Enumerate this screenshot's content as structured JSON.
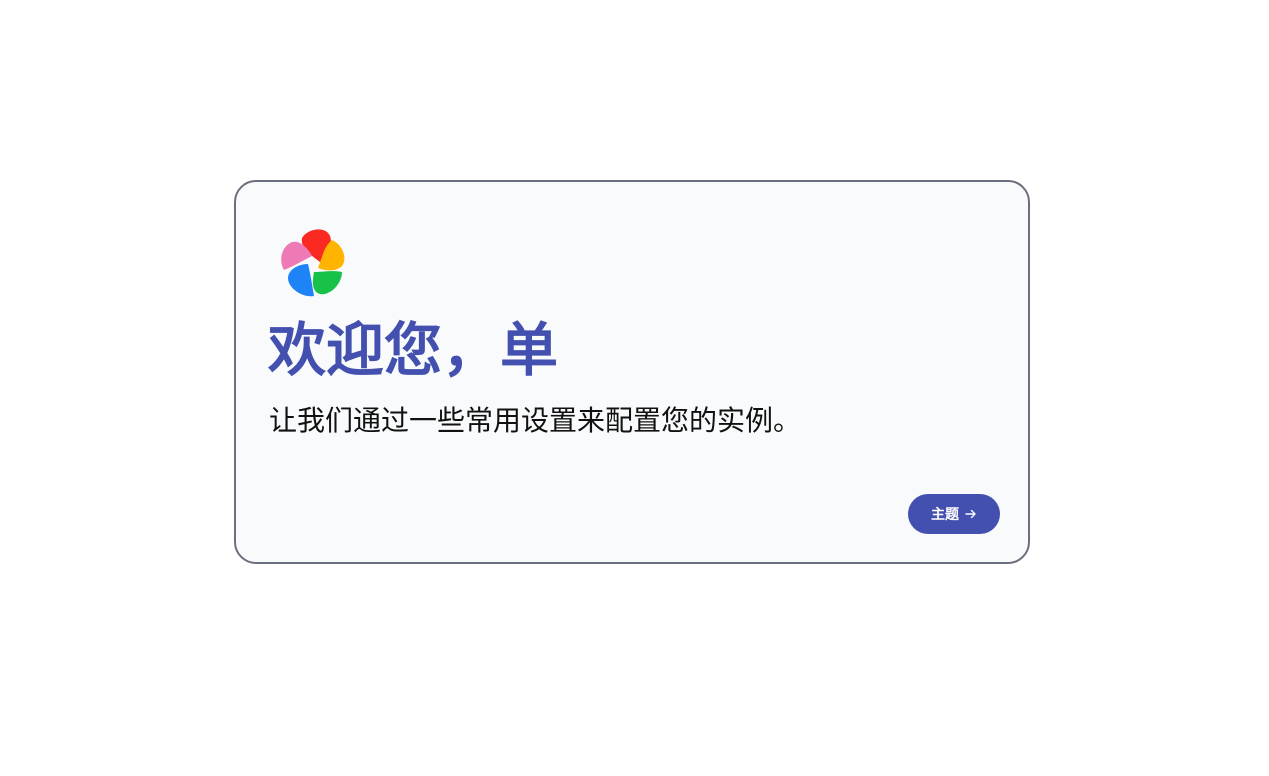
{
  "welcome": {
    "title": "欢迎您，单",
    "subtitle": "让我们通过一些常用设置来配置您的实例。"
  },
  "next_button": {
    "label": "主题",
    "icon": "arrow-right-icon"
  },
  "logo": {
    "icon": "immich-pinwheel-logo-icon",
    "colors": [
      "#fa2921",
      "#ffb400",
      "#18c249",
      "#1e83f7",
      "#ed79b5"
    ]
  },
  "colors": {
    "accent": "#4350af",
    "card_background": "#f8fafc",
    "card_border": "#6b6f80",
    "page_background": "#ffffff"
  }
}
